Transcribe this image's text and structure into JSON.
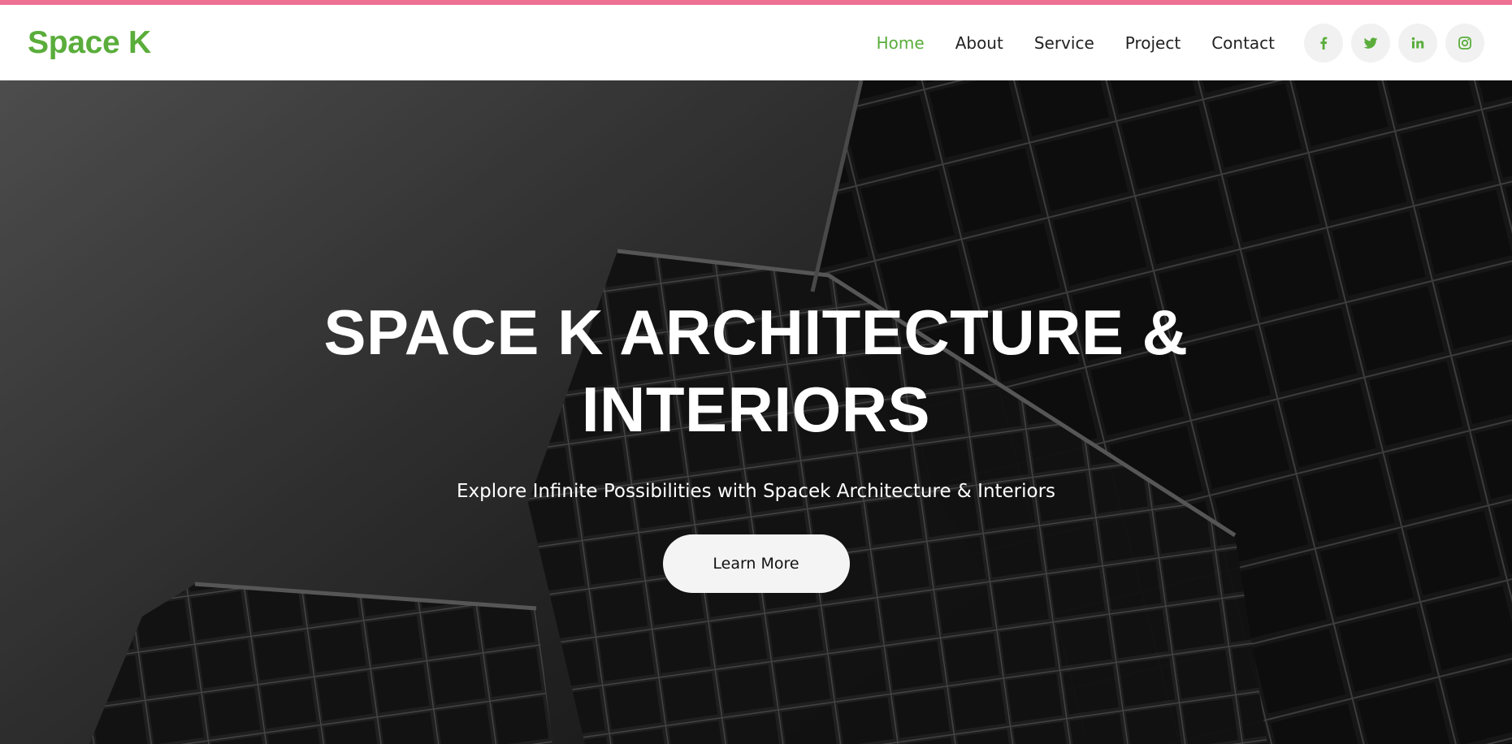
{
  "brand": {
    "name": "Space K",
    "color": "#5aad3b"
  },
  "accent_color": "#ee7093",
  "nav": {
    "items": [
      {
        "label": "Home",
        "active": true
      },
      {
        "label": "About",
        "active": false
      },
      {
        "label": "Service",
        "active": false
      },
      {
        "label": "Project",
        "active": false
      },
      {
        "label": "Contact",
        "active": false
      }
    ],
    "social": [
      {
        "icon": "facebook-icon"
      },
      {
        "icon": "twitter-icon"
      },
      {
        "icon": "linkedin-icon"
      },
      {
        "icon": "instagram-icon"
      }
    ]
  },
  "hero": {
    "title": "SPACE K ARCHITECTURE & INTERIORS",
    "subtitle": "Explore Infinite Possibilities with Spacek Architecture & Interiors",
    "button_label": "Learn More"
  }
}
